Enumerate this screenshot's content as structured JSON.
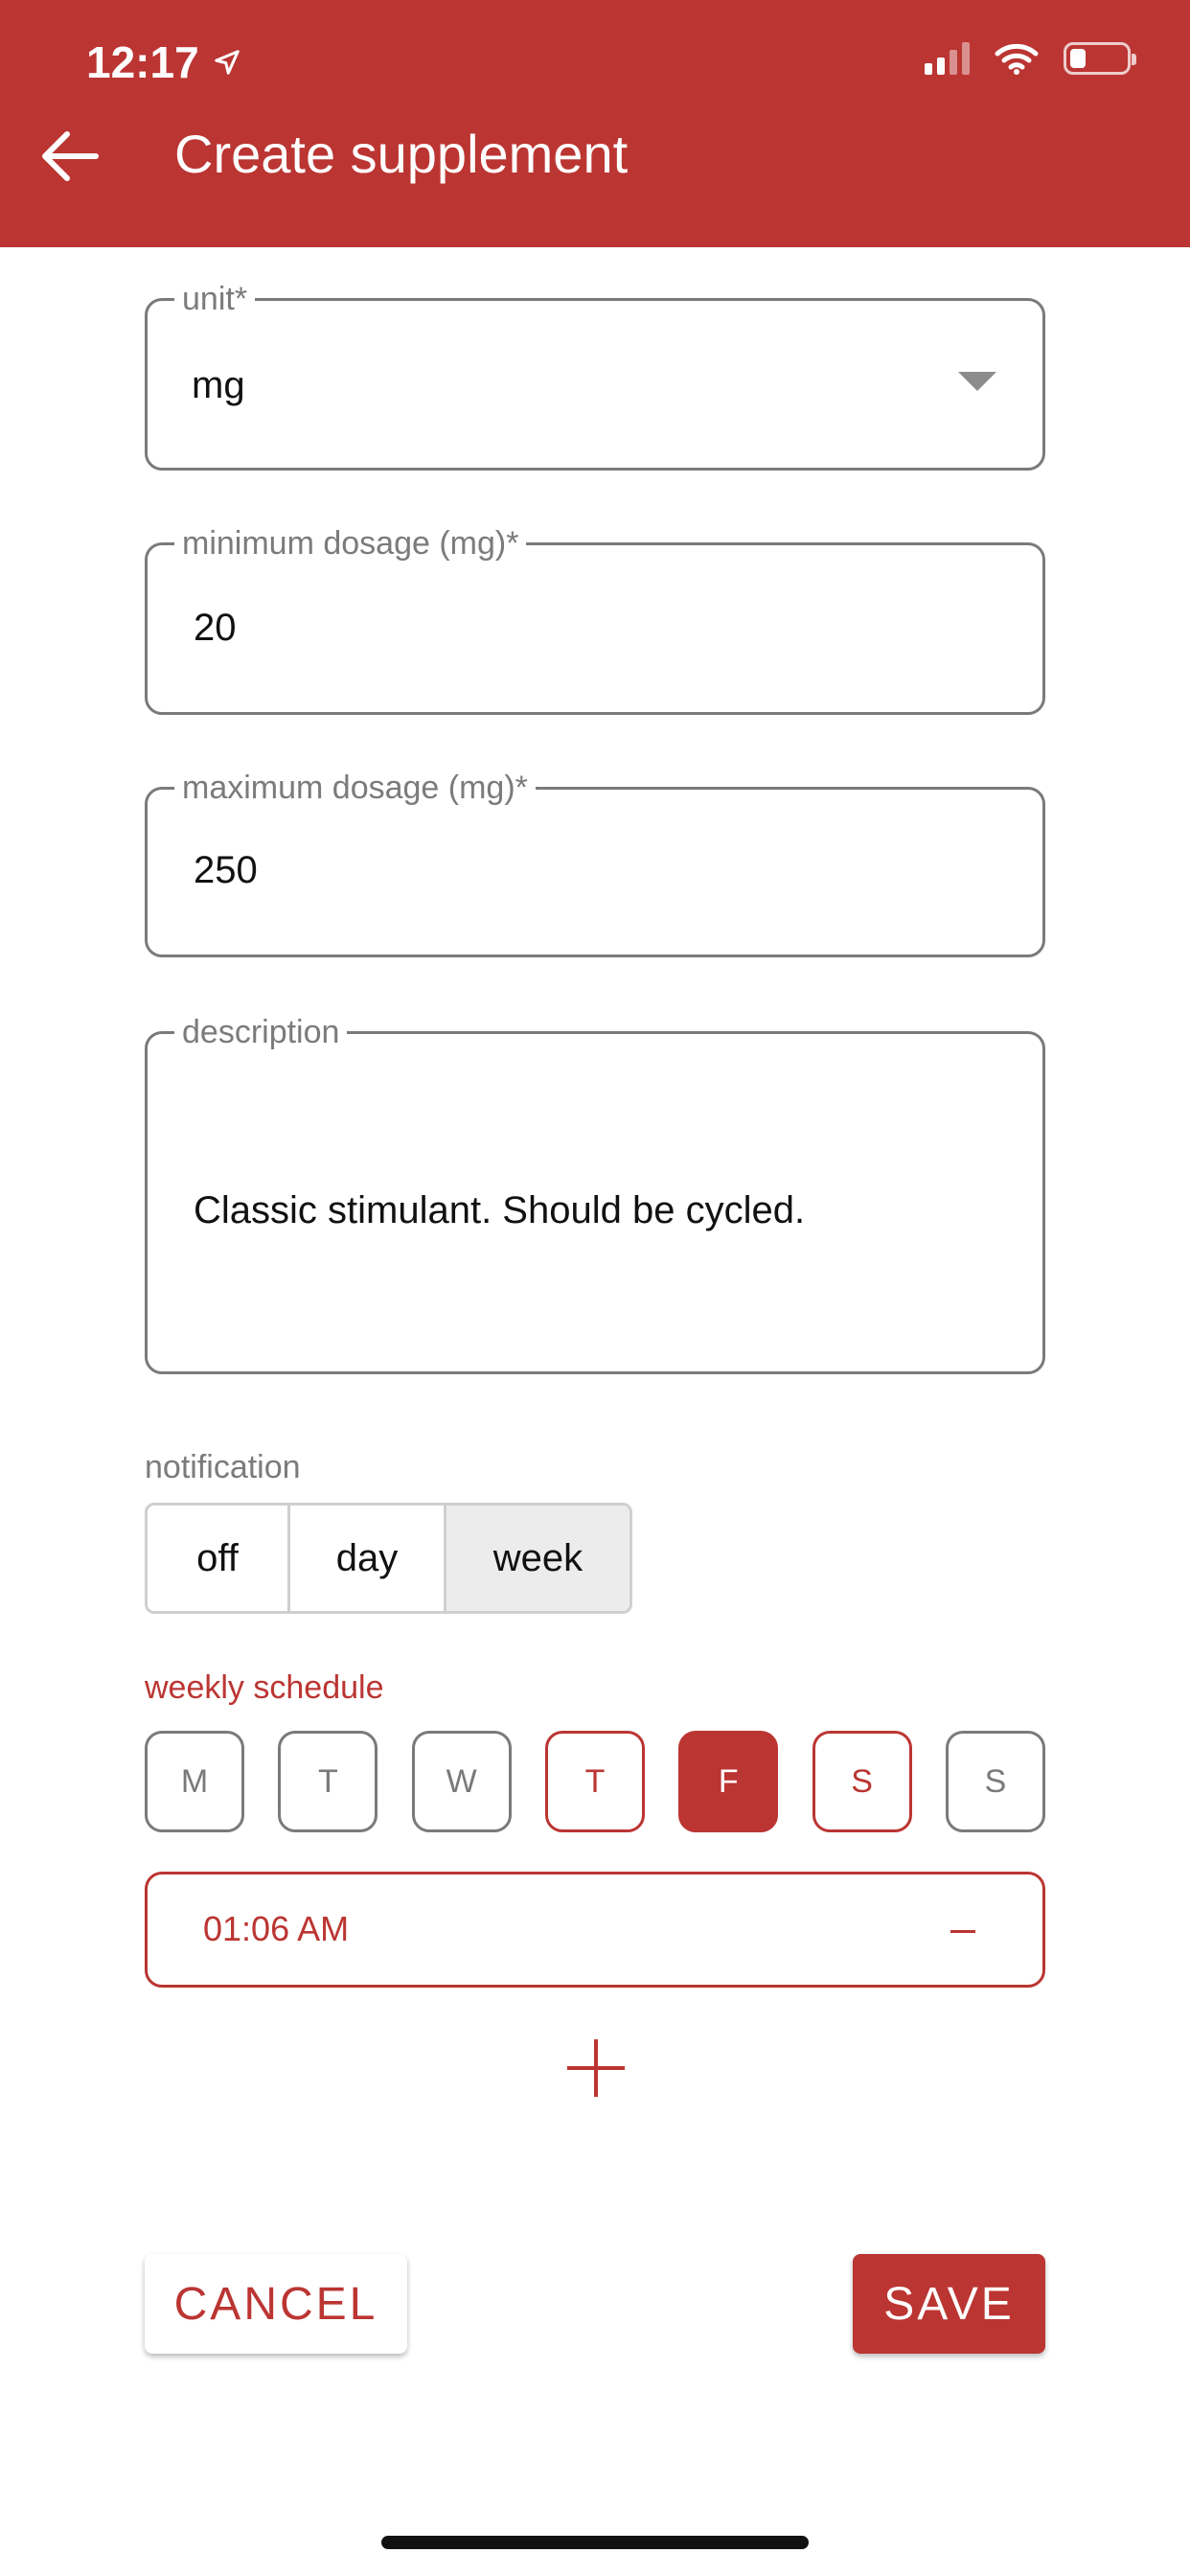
{
  "status_bar": {
    "time": "12:17"
  },
  "header": {
    "title": "Create supplement"
  },
  "form": {
    "unit": {
      "label": "unit*",
      "value": "mg"
    },
    "min_dosage": {
      "label": "minimum dosage (mg)*",
      "value": "20"
    },
    "max_dosage": {
      "label": "maximum dosage (mg)*",
      "value": "250"
    },
    "description": {
      "label": "description",
      "value": "Classic stimulant. Should be cycled."
    }
  },
  "notification": {
    "label": "notification",
    "options": [
      "off",
      "day",
      "week"
    ],
    "selected": "week"
  },
  "schedule": {
    "label": "weekly schedule",
    "days": [
      "M",
      "T",
      "W",
      "T",
      "F",
      "S",
      "S"
    ],
    "selected_days": [
      "Thursday",
      "Friday",
      "Saturday"
    ],
    "times": [
      "01:06 AM"
    ]
  },
  "actions": {
    "cancel": "CANCEL",
    "save": "SAVE"
  },
  "colors": {
    "primary": "#bb3532",
    "outline": "#7a7a7a",
    "label": "#7b7b7b"
  }
}
